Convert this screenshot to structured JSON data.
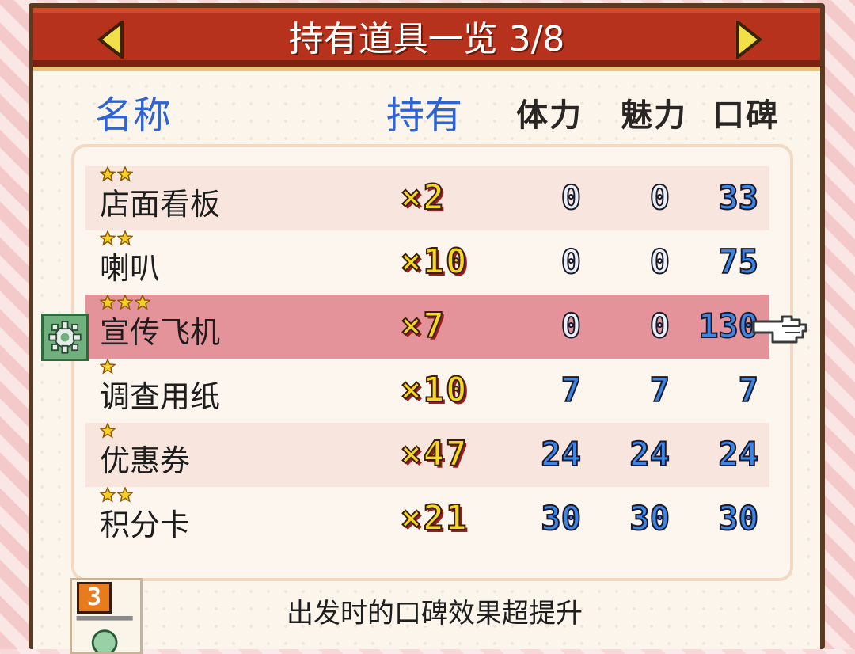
{
  "window": {
    "title": "持有道具一览 3/8"
  },
  "columns": {
    "name": "名称",
    "owned": "持有",
    "stamina": "体力",
    "charm": "魅力",
    "reputation": "口碑"
  },
  "items": [
    {
      "stars": 2,
      "name": "店面看板",
      "qty": "×2",
      "stamina": "0",
      "charm": "0",
      "reputation": "33",
      "selected": false
    },
    {
      "stars": 2,
      "name": "喇叭",
      "qty": "×10",
      "stamina": "0",
      "charm": "0",
      "reputation": "75",
      "selected": false
    },
    {
      "stars": 3,
      "name": "宣传飞机",
      "qty": "×7",
      "stamina": "0",
      "charm": "0",
      "reputation": "130",
      "selected": true
    },
    {
      "stars": 1,
      "name": "调查用纸",
      "qty": "×10",
      "stamina": "7",
      "charm": "7",
      "reputation": "7",
      "selected": false
    },
    {
      "stars": 1,
      "name": "优惠券",
      "qty": "×47",
      "stamina": "24",
      "charm": "24",
      "reputation": "24",
      "selected": false
    },
    {
      "stars": 2,
      "name": "积分卡",
      "qty": "×21",
      "stamina": "30",
      "charm": "30",
      "reputation": "30",
      "selected": false
    }
  ],
  "footer": {
    "badge": "3",
    "description": "出发时的口碑效果超提升"
  },
  "icons": {
    "prev": "arrow-left-icon",
    "next": "arrow-right-icon",
    "settings": "gear-icon",
    "cursor": "pointing-hand-icon",
    "star": "star-icon"
  },
  "colors": {
    "title_bar": "#b6321c",
    "header_blue": "#2f63d0",
    "selected_row": "#e5939a",
    "stat_blue": "#3d86e8",
    "qty_yellow": "#f6d81f"
  }
}
